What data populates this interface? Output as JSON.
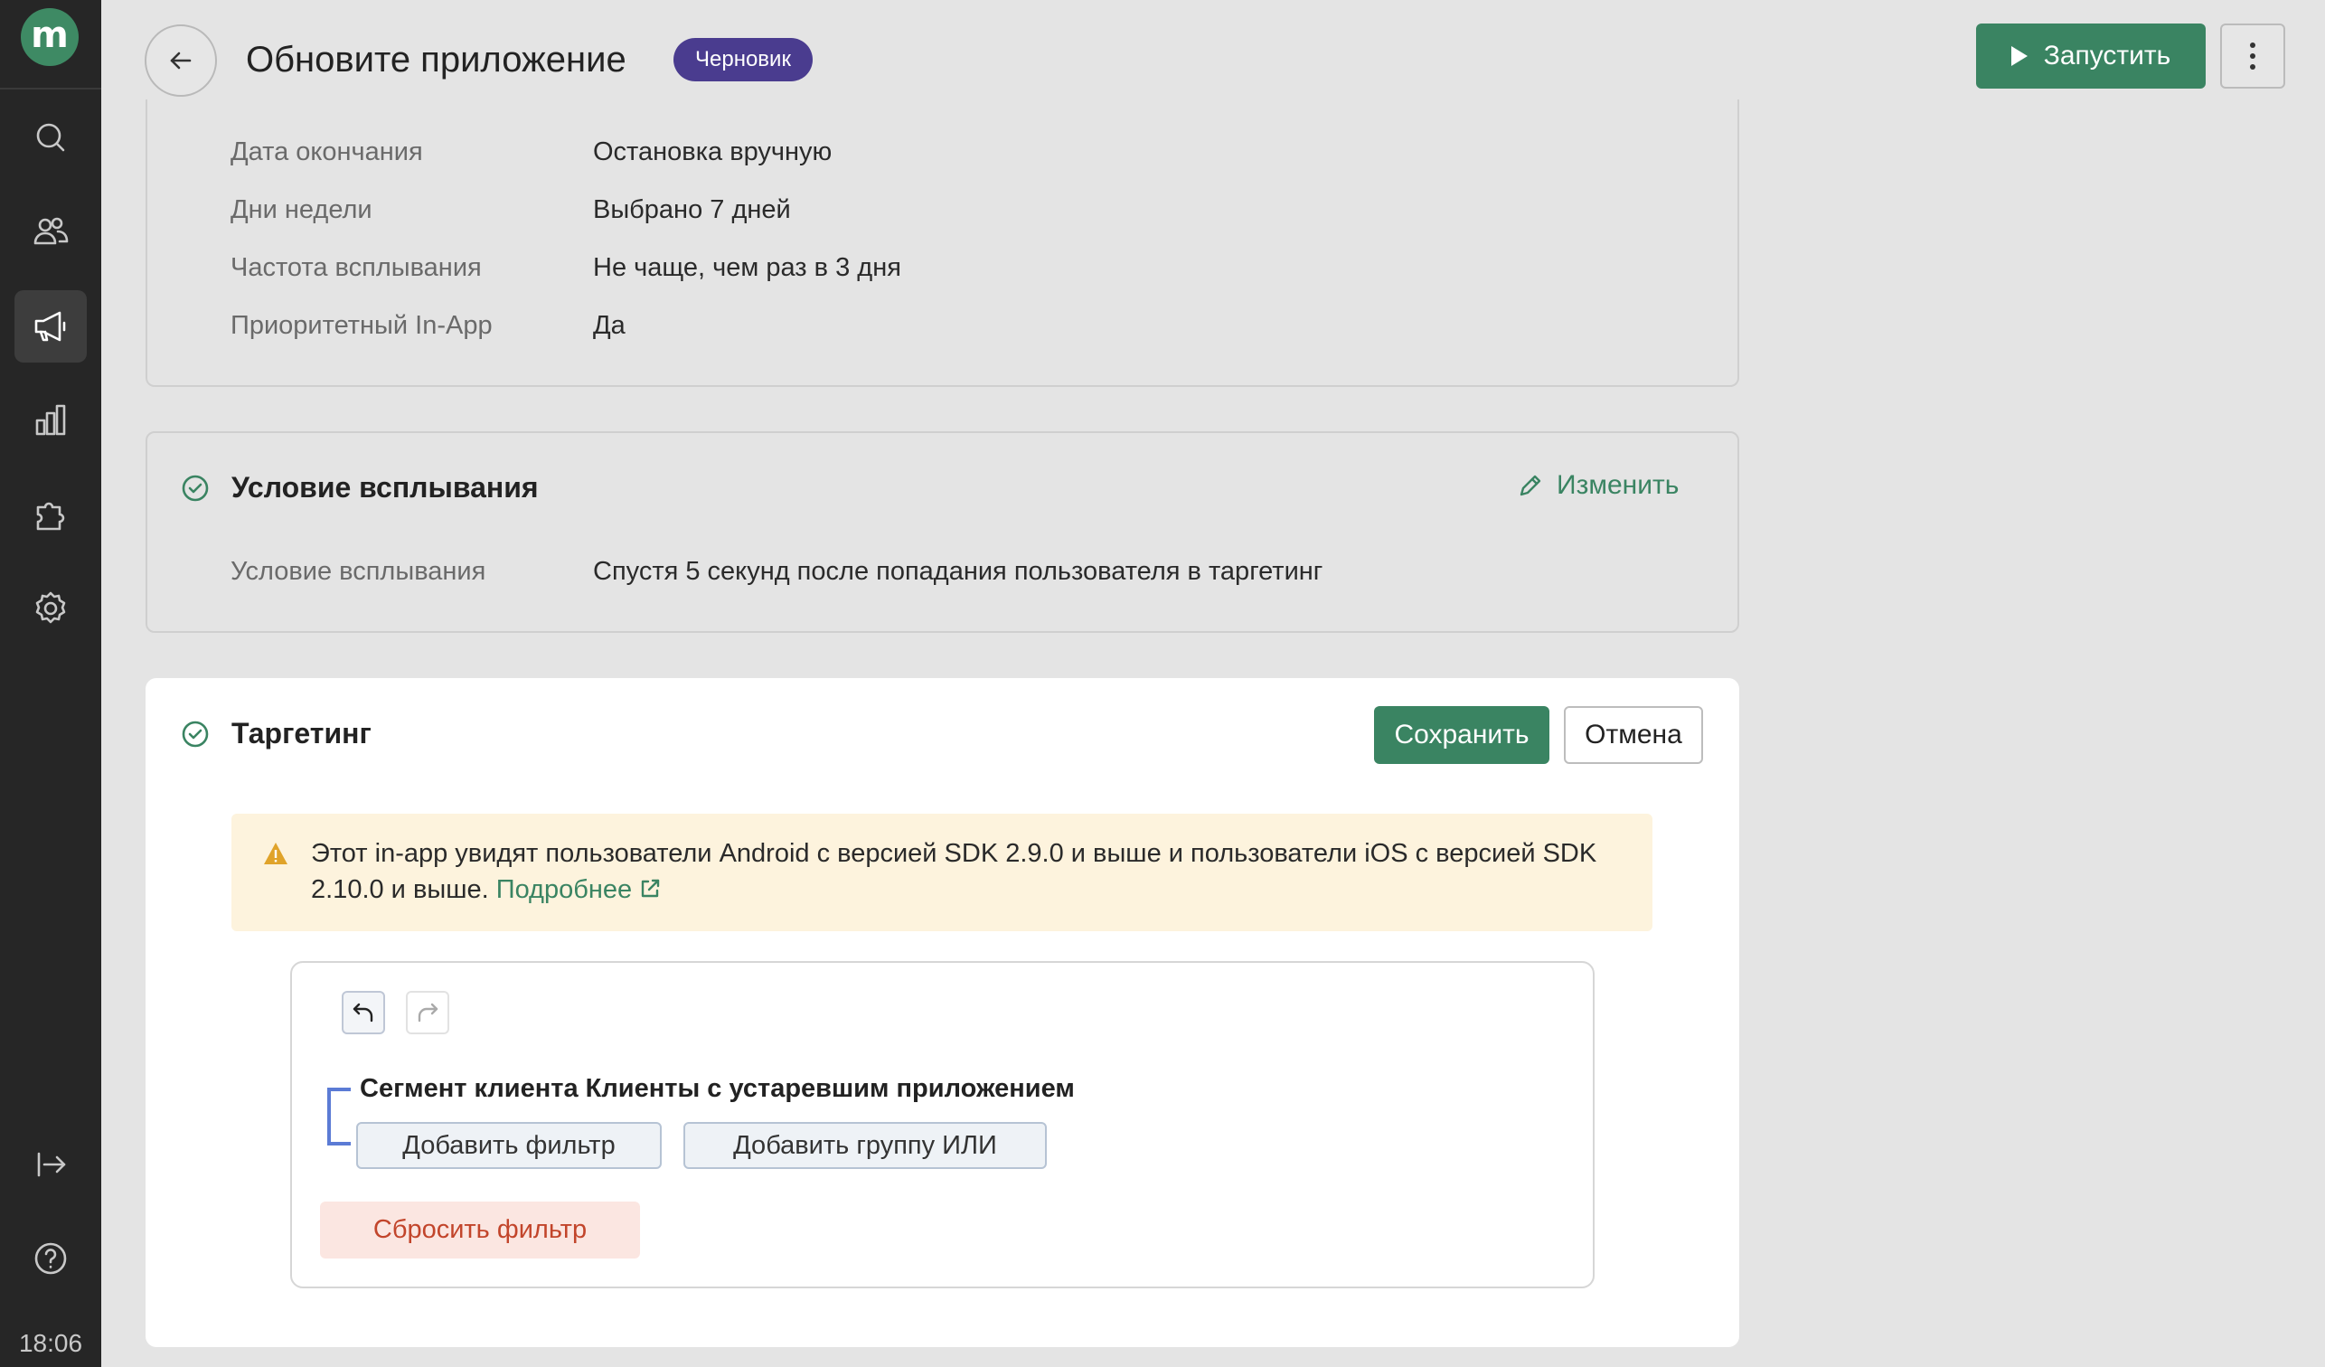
{
  "sidebar": {
    "logo_letter": "m",
    "nav": [
      "search-icon",
      "users-icon",
      "megaphone-icon",
      "bar-chart-icon",
      "puzzle-icon",
      "gear-icon"
    ],
    "active_item": "megaphone-icon",
    "bottom": [
      "logout-icon",
      "help-icon"
    ],
    "clock": "18:06"
  },
  "header": {
    "title": "Обновите приложение",
    "badge": "Черновик",
    "run_label": "Запустить"
  },
  "schedule_card": {
    "rows": [
      {
        "label": "Дата окончания",
        "value": "Остановка вручную"
      },
      {
        "label": "Дни недели",
        "value": "Выбрано 7 дней"
      },
      {
        "label": "Частота всплывания",
        "value": "Не чаще, чем раз в 3 дня"
      },
      {
        "label": "Приоритетный In-App",
        "value": "Да"
      }
    ]
  },
  "trigger_card": {
    "title": "Условие всплывания",
    "edit_label": "Изменить",
    "row": {
      "label": "Условие всплывания",
      "value": "Спустя 5 секунд после попадания пользователя в таргетинг"
    }
  },
  "targeting_card": {
    "title": "Таргетинг",
    "save_label": "Сохранить",
    "cancel_label": "Отмена",
    "warning_text": "Этот in-app увидят пользователи Android с версией SDK 2.9.0 и выше и пользователи iOS с версией SDK 2.10.0 и выше.",
    "warning_link": "Подробнее",
    "segment_title": "Сегмент клиента Клиенты с устаревшим приложением",
    "add_filter_label": "Добавить фильтр",
    "add_or_group_label": "Добавить группу ИЛИ",
    "reset_label": "Сбросить фильтр"
  },
  "colors": {
    "accent": "#3a8462",
    "badge": "#4a3c8f",
    "sidebar": "#262626",
    "warning_bg": "#fdf3dd",
    "reset_text": "#c2452b"
  }
}
